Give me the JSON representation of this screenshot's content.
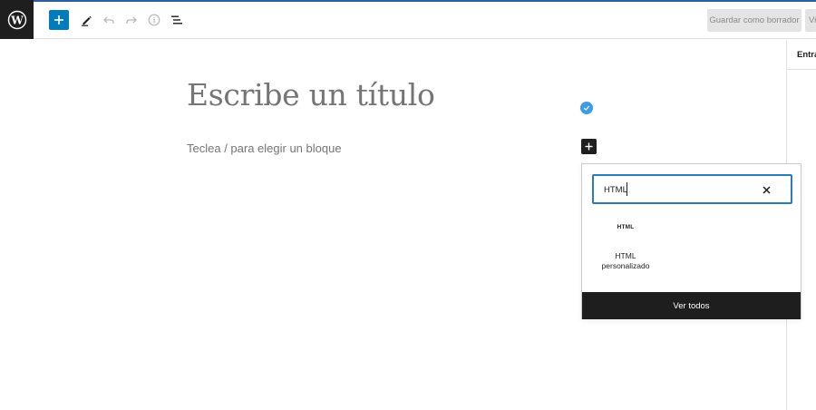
{
  "header": {
    "save_draft_label": "Guardar como borrador",
    "preview_label": "Vista previa",
    "icons": [
      "wordpress-logo-icon",
      "plus-icon",
      "pencil-icon",
      "undo-icon",
      "redo-icon",
      "info-icon",
      "list-view-icon"
    ],
    "accent_color": "#007cba",
    "top_border_color": "#2a5f9e"
  },
  "sidebar": {
    "tab_label": "Entrada"
  },
  "editor": {
    "title_placeholder": "Escribe un título",
    "paragraph_placeholder": "Teclea / para elegir un bloque"
  },
  "inserter": {
    "search_value": "HTML",
    "results": [
      {
        "icon_text": "HTML",
        "label_line1": "HTML",
        "label_line2": "personalizado"
      }
    ],
    "browse_all_label": "Ver todos"
  }
}
